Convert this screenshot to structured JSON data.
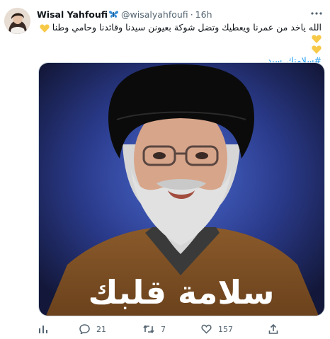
{
  "author": {
    "display_name": "Wisal Yahfoufi",
    "handle": "@wisalyahfoufi",
    "separator": "·",
    "timestamp": "16h"
  },
  "tweet": {
    "text": "الله ياخد من عمرنا ويعطيك وتضل شوكة بعيونن سيدنا وقائدنا وحامي وطنا",
    "hashtag": "#سلامتك_سيد"
  },
  "media": {
    "caption": "سلامة قلبك",
    "description_icon": "portrait-photo"
  },
  "actions": {
    "views_label": "",
    "replies": "21",
    "retweets": "7",
    "likes": "157"
  },
  "colors": {
    "accent": "#1d9bf0",
    "muted": "#536471",
    "heart": "#f7c948",
    "badge": "#1d9bf0",
    "image_bg": "#2c3e8c"
  }
}
